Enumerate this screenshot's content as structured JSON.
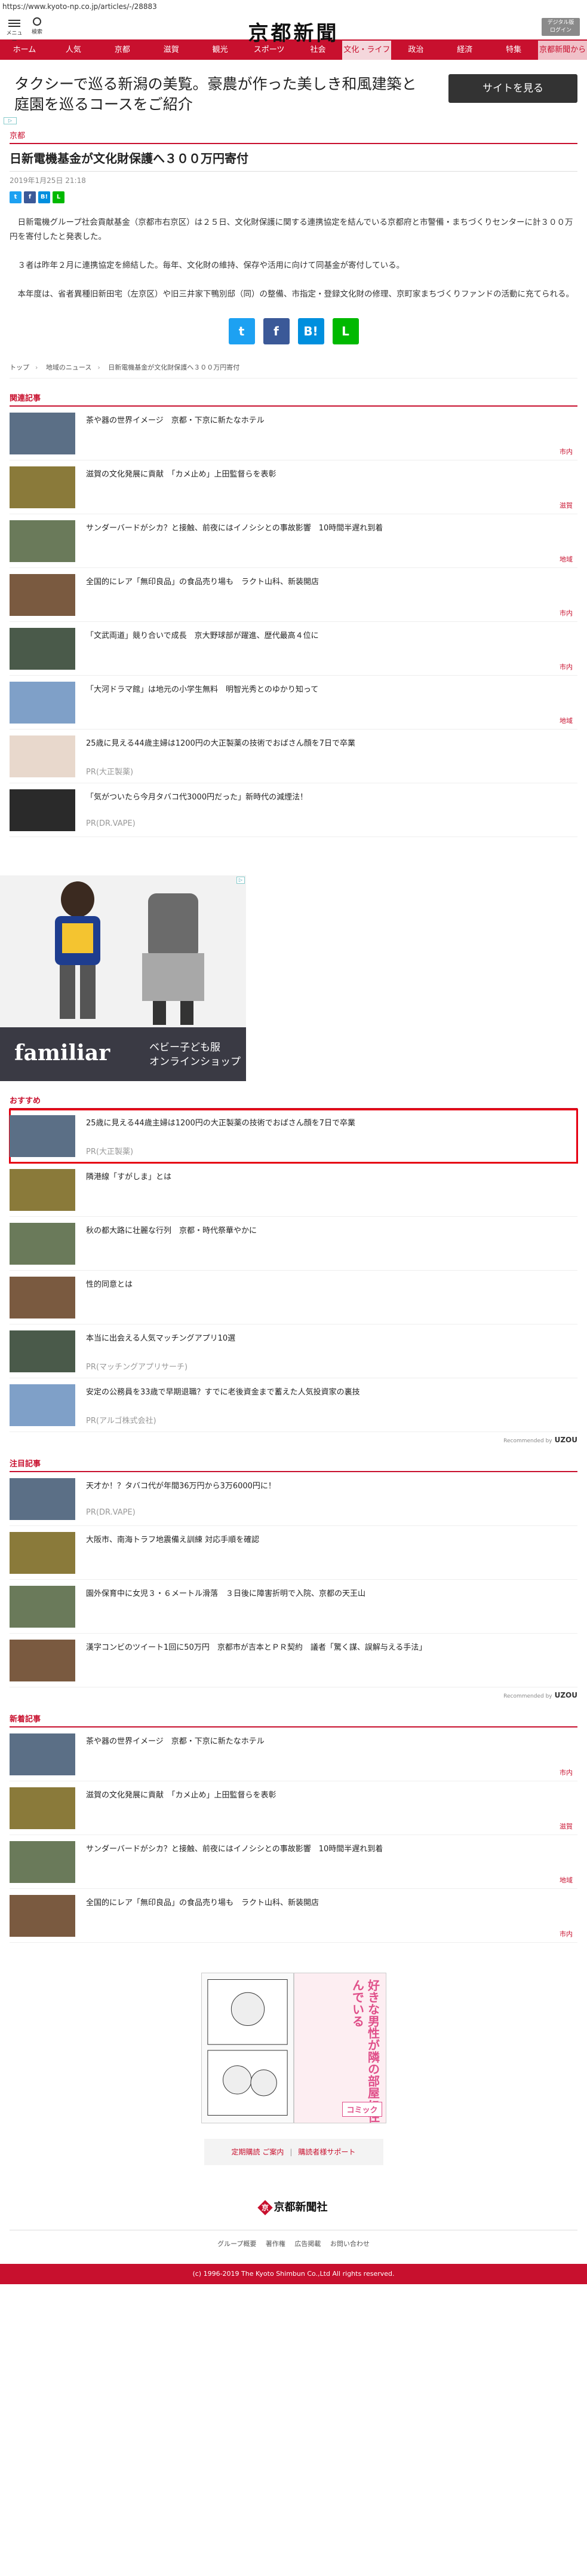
{
  "url": "https://www.kyoto-np.co.jp/articles/-/28883",
  "header": {
    "menu_label": "メニュー",
    "search_label": "検索",
    "logo": "京都新聞",
    "digital_btn": "デジタル版\nログイン"
  },
  "nav": [
    "ホーム",
    "人気",
    "京都",
    "滋賀",
    "観光",
    "スポーツ",
    "社会",
    "文化・ライフ",
    "政治",
    "経済",
    "特集",
    "京都新聞から"
  ],
  "nav_active_index": 7,
  "top_ad": {
    "text": "タクシーで巡る新潟の美覧。豪農が作った美しき和風建築と庭園を巡るコースをご紹介",
    "cta": "サイトを見る"
  },
  "article": {
    "category": "京都",
    "title": "日新電機基金が文化財保護へ３００万円寄付",
    "date": "2019年1月25日 21:18",
    "paragraphs": [
      "日新電機グループ社会貢献基金（京都市右京区）は２５日、文化財保護に関する連携協定を結んでいる京都府と市警備・まちづくりセンターに計３００万円を寄付したと発表した。",
      "３者は昨年２月に連携協定を締結した。毎年、文化財の維持、保存や活用に向けて同基金が寄付している。",
      "本年度は、省者異種旧新田宅（左京区）や旧三井家下鴨別邸（同）の整備、市指定・登録文化財の修理、京町家まちづくりファンドの活動に充てられる。"
    ],
    "share_small": [
      "t",
      "f",
      "B!",
      "L"
    ],
    "share_large": [
      "t",
      "f",
      "B!",
      "L"
    ]
  },
  "breadcrumb": [
    "トップ",
    "地域のニュース",
    "日新電機基金が文化財保護へ３００万円寄付"
  ],
  "related": {
    "heading": "関連記事",
    "items": [
      {
        "title": "茶や器の世界イメージ　京都・下京に新たなホテル",
        "tag": "市内"
      },
      {
        "title": "滋賀の文化発展に貢献　「カメ止め」上田監督らを表彰",
        "tag": "滋賀"
      },
      {
        "title": "サンダーバードがシカ？と接触、前夜にはイノシシとの事故影響　10時間半遅れ到着",
        "tag": "地域"
      },
      {
        "title": "全国的にレア「無印良品」の食品売り場も　ラクト山科、新装開店",
        "tag": "市内"
      },
      {
        "title": "「文武両道」競り合いで成長　京大野球部が躍進、歴代最高４位に",
        "tag": "市内"
      },
      {
        "title": "「大河ドラマ館」は地元の小学生無料　明智光秀とのゆかり知って",
        "tag": "地域"
      },
      {
        "title": "25歳に見える44歳主婦は1200円の大正製薬の技術でおばさん顔を7日で卒業",
        "pr": "PR(大正製薬)"
      },
      {
        "title": "「気がついたら今月タバコ代3000円だった」新時代の減煙法！",
        "pr": "PR(DR.VAPE)"
      }
    ]
  },
  "big_ad": {
    "brand": "familiar",
    "sub": "ベビー子ども服\nオンラインショップ"
  },
  "recommend": {
    "heading": "おすすめ",
    "items": [
      {
        "title": "25歳に見える44歳主婦は1200円の大正製薬の技術でおばさん顔を7日で卒業",
        "pr": "PR(大正製薬)"
      },
      {
        "title": "隣港線「すがしま」とは"
      },
      {
        "title": "秋の都大路に壮麗な行列　京都・時代祭華やかに"
      },
      {
        "title": "性的同意とは"
      },
      {
        "title": "本当に出会える人気マッチングアプリ10選",
        "pr": "PR(マッチングアプリサーチ)"
      },
      {
        "title": "安定の公務員を33歳で早期退職？すでに老後資金まで蓄えた人気投資家の裏技",
        "pr": "PR(アルゴ株式会社)"
      }
    ],
    "by_label": "Recommended by",
    "by_brand": "UZOU"
  },
  "attention": {
    "heading": "注目記事",
    "items": [
      {
        "title": "天才か！？タバコ代が年間36万円から3万6000円に！",
        "pr": "PR(DR.VAPE)"
      },
      {
        "title": "大阪市、南海トラフ地震備え訓練 対応手順を確認"
      },
      {
        "title": "園外保育中に女児３・６メートル滑落　３日後に障害折明で入院、京都の天王山"
      },
      {
        "title": "漢字コンビのツイート1回に50万円　京都市が吉本とＰＲ契約　議者「驚く謀、誤解与える手法」"
      }
    ],
    "by_label": "Recommended by",
    "by_brand": "UZOU"
  },
  "newest": {
    "heading": "新着記事",
    "items": [
      {
        "title": "茶や器の世界イメージ　京都・下京に新たなホテル",
        "tag": "市内"
      },
      {
        "title": "滋賀の文化発展に貢献　「カメ止め」上田監督らを表彰",
        "tag": "滋賀"
      },
      {
        "title": "サンダーバードがシカ？と接触、前夜にはイノシシとの事故影響　10時間半遅れ到着",
        "tag": "地域"
      },
      {
        "title": "全国的にレア「無印良品」の食品売り場も　ラクト山科、新装開店",
        "tag": "市内"
      }
    ]
  },
  "mini_ad": {
    "vtext": "好きな男性が隣の部屋に住んでいる",
    "comic_tag": "コミック"
  },
  "footer": {
    "link1": "定期購読 ご案内",
    "link2": "購読者様サポート",
    "logo": "京都新聞社",
    "nav": [
      "グループ概要",
      "著作権",
      "広告掲載",
      "お問い合わせ"
    ],
    "copyright": "(c) 1996-2019 The Kyoto Shimbun Co.,Ltd All rights reserved."
  }
}
